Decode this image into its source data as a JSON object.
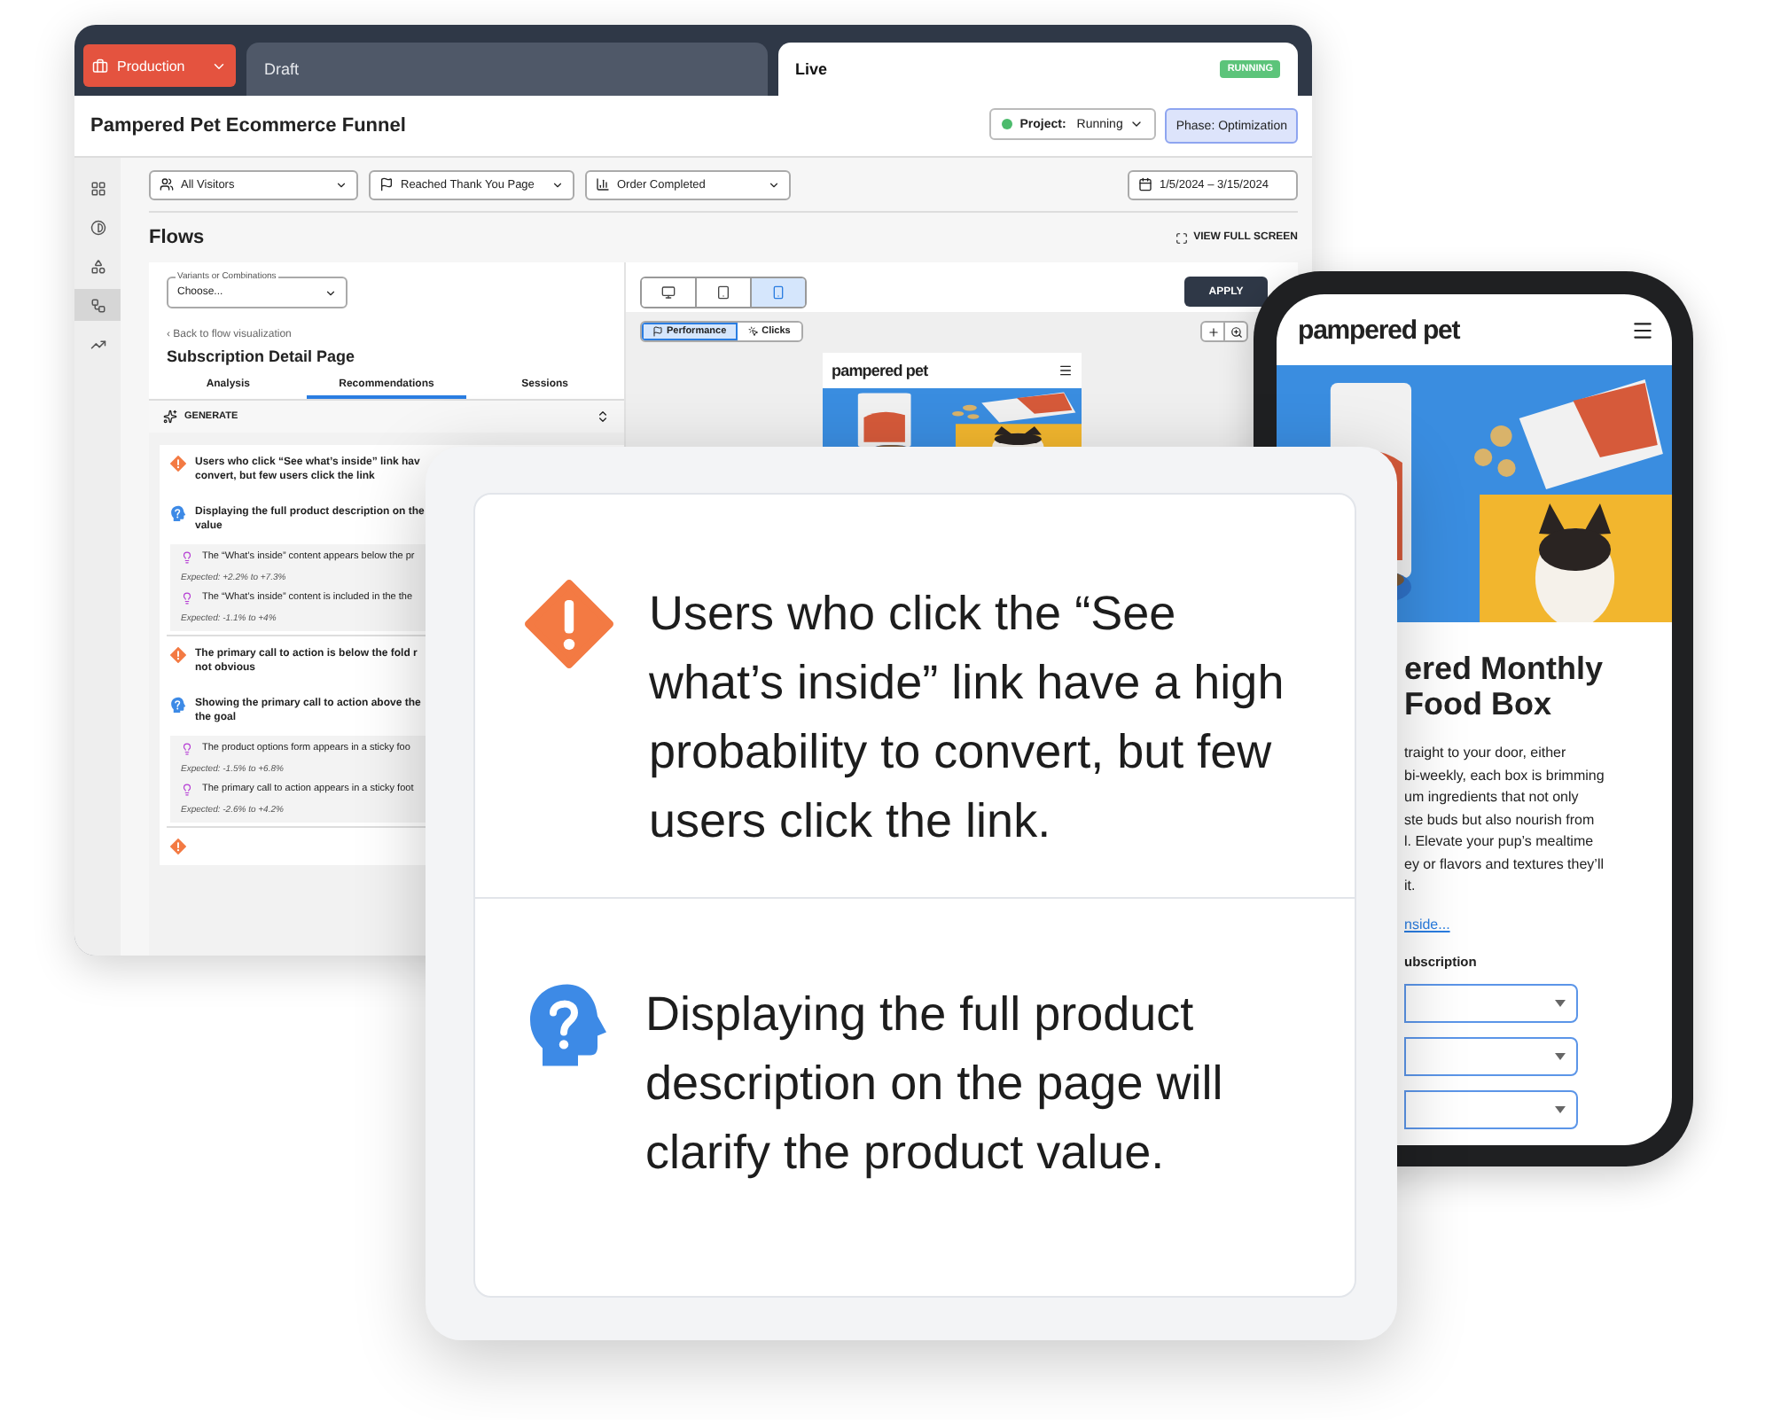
{
  "app": {
    "environment_button": "Production",
    "tabs": [
      {
        "label": "Draft",
        "selected": false
      },
      {
        "label": "Live",
        "selected": true,
        "badge": "RUNNING"
      }
    ],
    "title": "Pampered Pet Ecommerce Funnel",
    "project_status": {
      "label": "Project:",
      "value": "Running",
      "color": "#4cbb6c"
    },
    "phase": "Phase: Optimization",
    "sidebar": [
      {
        "kind": "grid",
        "selected": false
      },
      {
        "kind": "contrast",
        "selected": false
      },
      {
        "kind": "shapes",
        "selected": false
      },
      {
        "kind": "flows",
        "selected": true
      },
      {
        "kind": "trend",
        "selected": false
      }
    ],
    "filters": [
      {
        "kind": "audience",
        "label": "All Visitors"
      },
      {
        "kind": "goal",
        "label": "Reached Thank You Page"
      },
      {
        "kind": "metric",
        "label": "Order Completed"
      }
    ],
    "date_range": "1/5/2024 – 3/15/2024",
    "section_title": "Flows",
    "full_screen": "VIEW FULL SCREEN",
    "variant_select": {
      "label": "Variants or Combinations",
      "value": "Choose..."
    },
    "back_link": "‹ Back to flow visualization",
    "page_title": "Subscription Detail Page",
    "panel_tabs": [
      {
        "label": "Analysis",
        "selected": false
      },
      {
        "label": "Recommendations",
        "selected": true
      },
      {
        "label": "Sessions",
        "selected": false
      }
    ],
    "generate": "GENERATE",
    "recommendations": [
      {
        "kind": "issue",
        "lines": [
          "Users who click “See what’s inside” link hav",
          "convert, but few users click the link"
        ]
      },
      {
        "kind": "hypothesis",
        "lines": [
          "Displaying the full product description on the",
          "value"
        ],
        "ideas": [
          {
            "text": "The “What’s inside” content appears below the pr",
            "expected": "Expected: +2.2% to +7.3%"
          },
          {
            "text": "The “What’s inside” content is included in the the",
            "expected": "Expected: -1.1% to +4%"
          }
        ]
      },
      {
        "kind": "issue",
        "lines": [
          "The primary call to action is below the fold r",
          "not obvious"
        ]
      },
      {
        "kind": "hypothesis",
        "lines": [
          "Showing the primary call to action above the",
          "the goal"
        ],
        "ideas": [
          {
            "text": "The product options form appears in a sticky foo",
            "expected": "Expected: -1.5% to +6.8%"
          },
          {
            "text": "The primary call to action appears in a sticky foot",
            "expected": "Expected: -2.6% to +4.2%"
          }
        ]
      },
      {
        "kind": "issue"
      }
    ],
    "device_views": [
      {
        "kind": "desktop",
        "selected": false
      },
      {
        "kind": "tablet",
        "selected": false
      },
      {
        "kind": "mobile",
        "selected": true
      }
    ],
    "apply": "APPLY",
    "view_modes": [
      {
        "kind": "performance",
        "label": "Performance",
        "selected": true
      },
      {
        "kind": "clicks",
        "label": "Clicks",
        "selected": false
      }
    ],
    "preview": {
      "logo": "pampered pet"
    }
  },
  "callout": {
    "items": [
      {
        "kind": "issue",
        "text": "Users who click the “See what’s inside” link have a high probability to convert, but few users click the link."
      },
      {
        "kind": "hypothesis",
        "text": "Displaying the full product description on the page will clarify the product value."
      }
    ]
  },
  "phone": {
    "logo": "pampered pet",
    "heading_lines": [
      "ered Monthly",
      "Food Box"
    ],
    "description_lines": [
      "traight to your door, either",
      "bi-weekly, each box is brimming",
      "um ingredients that not only",
      "ste buds but also nourish from",
      "l. Elevate your pup’s mealtime",
      "ey or flavors and textures they’ll",
      "it."
    ],
    "link": "nside...",
    "option_label": "ubscription"
  }
}
